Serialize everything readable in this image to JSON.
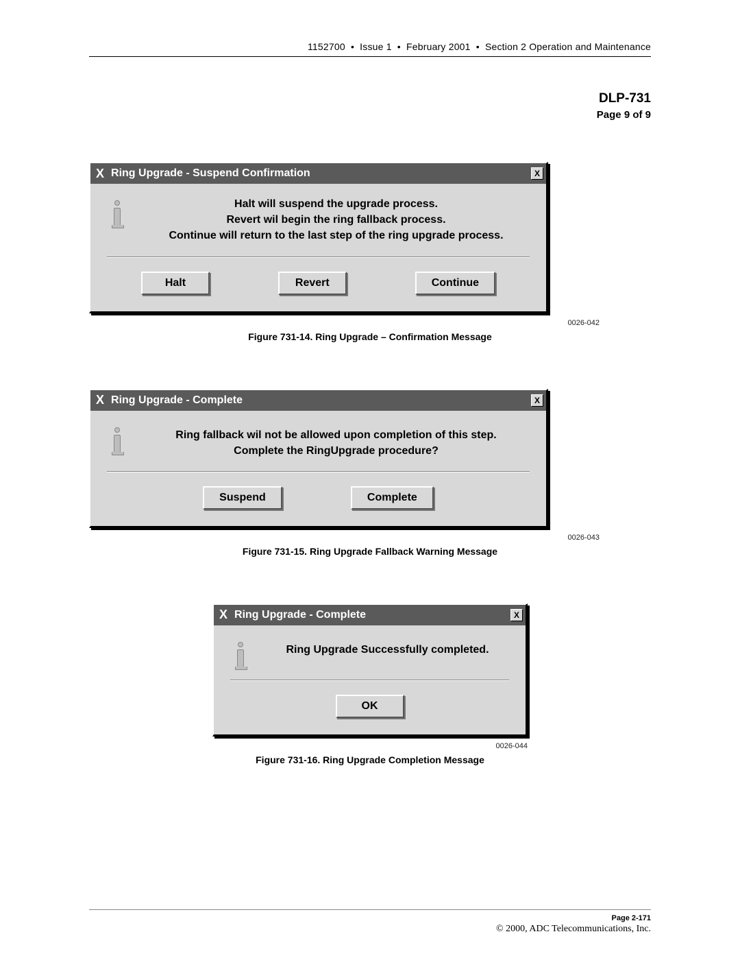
{
  "header": {
    "doc_id": "1152700",
    "issue": "Issue 1",
    "date": "February 2001",
    "section": "Section 2 Operation and Maintenance"
  },
  "title": {
    "dlp": "DLP-731",
    "page": "Page 9 of 9"
  },
  "dialog1": {
    "title": "Ring Upgrade - Suspend Confirmation",
    "line1": "Halt will suspend the upgrade process.",
    "line2": "Revert wil begin the ring fallback process.",
    "line3": "Continue will return to the last step of the ring upgrade process.",
    "btn_halt": "Halt",
    "btn_revert": "Revert",
    "btn_continue": "Continue",
    "fig_id": "0026-042",
    "fig_caption": "Figure 731-14.  Ring Upgrade – Confirmation Message"
  },
  "dialog2": {
    "title": "Ring Upgrade - Complete",
    "line1": "Ring fallback wil not be allowed upon completion of this step.",
    "line2": "Complete the RingUpgrade procedure?",
    "btn_suspend": "Suspend",
    "btn_complete": "Complete",
    "fig_id": "0026-043",
    "fig_caption": "Figure 731-15.  Ring Upgrade Fallback Warning Message"
  },
  "dialog3": {
    "title": "Ring Upgrade - Complete",
    "line1": "Ring Upgrade Successfully completed.",
    "btn_ok": "OK",
    "fig_id": "0026-044",
    "fig_caption": "Figure 731-16.  Ring Upgrade Completion Message"
  },
  "footer": {
    "page": "Page 2-171",
    "copyright": "© 2000, ADC Telecommunications, Inc."
  },
  "glyphs": {
    "close_x": "X",
    "title_x": "X"
  }
}
